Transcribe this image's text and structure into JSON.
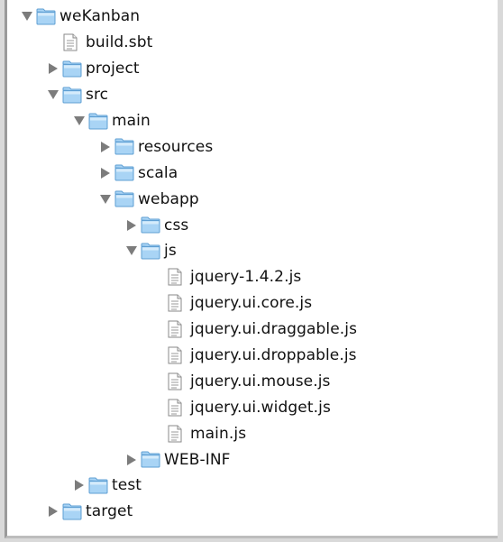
{
  "tree": {
    "nodes": [
      {
        "label": "weKanban",
        "type": "folder",
        "depth": 0,
        "expanded": true
      },
      {
        "label": "build.sbt",
        "type": "file",
        "depth": 1
      },
      {
        "label": "project",
        "type": "folder",
        "depth": 1,
        "expanded": false
      },
      {
        "label": "src",
        "type": "folder",
        "depth": 1,
        "expanded": true
      },
      {
        "label": "main",
        "type": "folder",
        "depth": 2,
        "expanded": true
      },
      {
        "label": "resources",
        "type": "folder",
        "depth": 3,
        "expanded": false
      },
      {
        "label": "scala",
        "type": "folder",
        "depth": 3,
        "expanded": false
      },
      {
        "label": "webapp",
        "type": "folder",
        "depth": 3,
        "expanded": true
      },
      {
        "label": "css",
        "type": "folder",
        "depth": 4,
        "expanded": false
      },
      {
        "label": "js",
        "type": "folder",
        "depth": 4,
        "expanded": true
      },
      {
        "label": "jquery-1.4.2.js",
        "type": "file",
        "depth": 5
      },
      {
        "label": "jquery.ui.core.js",
        "type": "file",
        "depth": 5
      },
      {
        "label": "jquery.ui.draggable.js",
        "type": "file",
        "depth": 5
      },
      {
        "label": "jquery.ui.droppable.js",
        "type": "file",
        "depth": 5
      },
      {
        "label": "jquery.ui.mouse.js",
        "type": "file",
        "depth": 5
      },
      {
        "label": "jquery.ui.widget.js",
        "type": "file",
        "depth": 5
      },
      {
        "label": "main.js",
        "type": "file",
        "depth": 5
      },
      {
        "label": "WEB-INF",
        "type": "folder",
        "depth": 4,
        "expanded": false
      },
      {
        "label": "test",
        "type": "folder",
        "depth": 2,
        "expanded": false
      },
      {
        "label": "target",
        "type": "folder",
        "depth": 1,
        "expanded": false
      }
    ]
  },
  "colors": {
    "folder_body": "#a9d4f5",
    "folder_edge": "#5f9fd3",
    "disclosure": "#7c7c7c"
  }
}
